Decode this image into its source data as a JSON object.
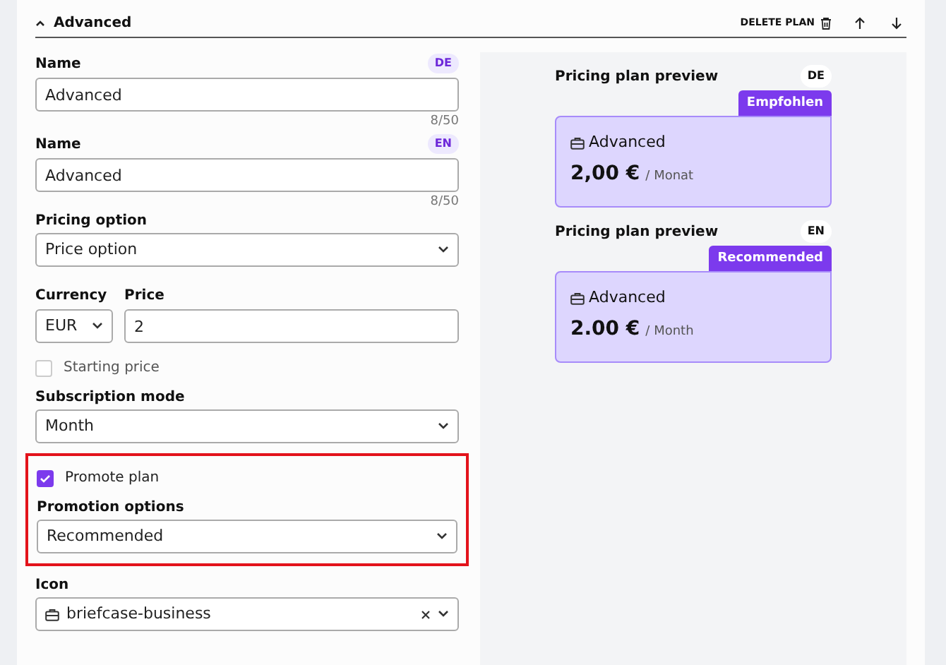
{
  "section": {
    "title": "Advanced",
    "expanded": true,
    "delete_label": "DELETE PLAN"
  },
  "fields": [
    {
      "kind": "text",
      "label": "Name",
      "lang": "DE",
      "value": "Advanced",
      "counter": "8/50"
    },
    {
      "kind": "text",
      "label": "Name",
      "lang": "EN",
      "value": "Advanced",
      "counter": "8/50"
    },
    {
      "kind": "select",
      "label": "Pricing option",
      "value": "Price option"
    },
    {
      "kind": "pair",
      "currency_label": "Currency",
      "currency": "EUR",
      "price_label": "Price",
      "price": "2"
    },
    {
      "kind": "checkbox",
      "label": "Starting price",
      "checked": false
    },
    {
      "kind": "select",
      "label": "Subscription mode",
      "value": "Month"
    },
    {
      "kind": "group",
      "highlighted": true,
      "fields": [
        {
          "kind": "checkbox",
          "label": "Promote plan",
          "checked": true
        },
        {
          "kind": "select",
          "label": "Promotion options",
          "value": "Recommended"
        }
      ]
    },
    {
      "kind": "select",
      "label": "Icon",
      "value": "briefcase-business",
      "icon": true,
      "clearable": true
    }
  ],
  "previews": [
    {
      "title": "Pricing plan preview",
      "lang": "DE",
      "badge": "Empfohlen",
      "name": "Advanced",
      "price": "2,00 €",
      "period": "/ Monat"
    },
    {
      "title": "Pricing plan preview",
      "lang": "EN",
      "badge": "Recommended",
      "name": "Advanced",
      "price": "2.00 €",
      "period": "/ Month"
    }
  ]
}
